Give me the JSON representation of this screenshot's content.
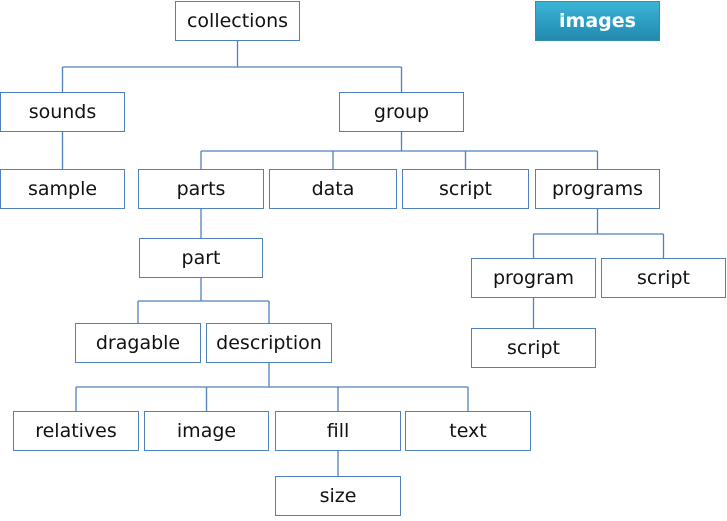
{
  "diagram": {
    "type": "tree",
    "colors": {
      "line": "#4f81bd",
      "box_border": "#4f81bd",
      "highlight_fill": "#31a9ce",
      "highlight_text": "#ffffff"
    },
    "nodes": [
      {
        "id": "collections",
        "label": "collections",
        "parent": null
      },
      {
        "id": "images",
        "label": "images",
        "parent": null,
        "highlight": true
      },
      {
        "id": "sounds",
        "label": "sounds",
        "parent": "collections"
      },
      {
        "id": "group",
        "label": "group",
        "parent": "collections"
      },
      {
        "id": "sample",
        "label": "sample",
        "parent": "sounds"
      },
      {
        "id": "parts",
        "label": "parts",
        "parent": "group"
      },
      {
        "id": "data",
        "label": "data",
        "parent": "group"
      },
      {
        "id": "group-script",
        "label": "script",
        "parent": "group"
      },
      {
        "id": "programs",
        "label": "programs",
        "parent": "group"
      },
      {
        "id": "part",
        "label": "part",
        "parent": "parts"
      },
      {
        "id": "program",
        "label": "program",
        "parent": "programs"
      },
      {
        "id": "programs-script",
        "label": "script",
        "parent": "programs"
      },
      {
        "id": "program-script",
        "label": "script",
        "parent": "program"
      },
      {
        "id": "dragable",
        "label": "dragable",
        "parent": "part"
      },
      {
        "id": "description",
        "label": "description",
        "parent": "part"
      },
      {
        "id": "relatives",
        "label": "relatives",
        "parent": "description"
      },
      {
        "id": "image",
        "label": "image",
        "parent": "description"
      },
      {
        "id": "fill",
        "label": "fill",
        "parent": "description"
      },
      {
        "id": "text",
        "label": "text",
        "parent": "description"
      },
      {
        "id": "size",
        "label": "size",
        "parent": "fill"
      }
    ]
  }
}
